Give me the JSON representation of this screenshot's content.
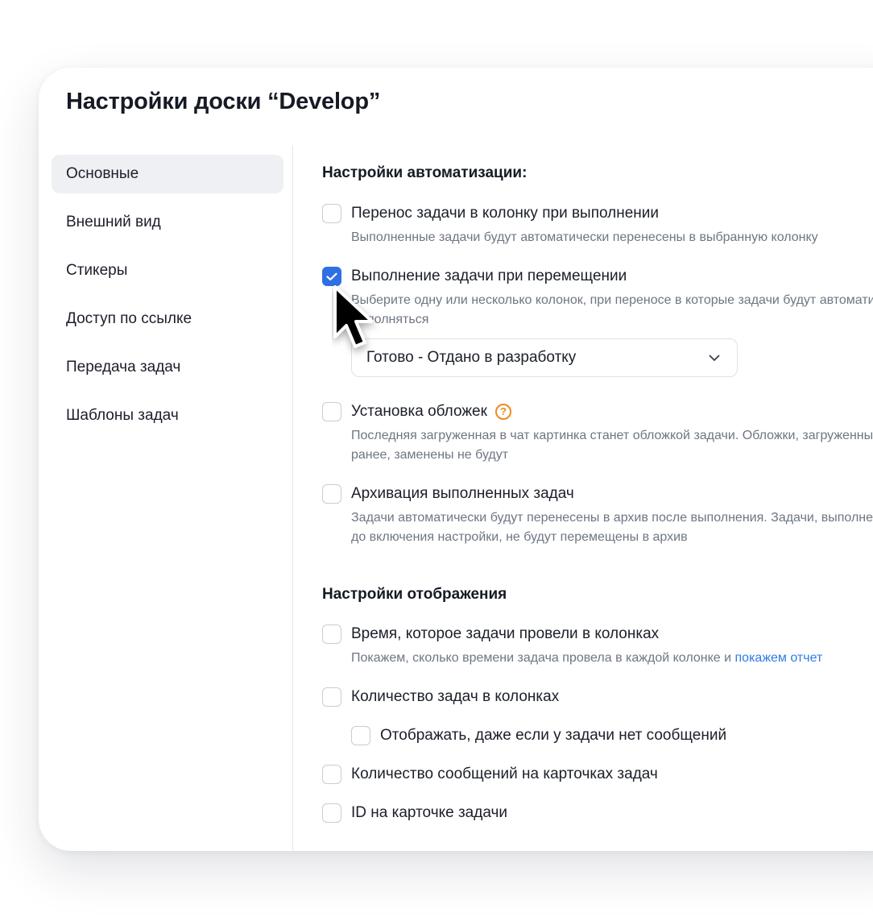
{
  "dialog": {
    "title": "Настройки доски “Develop”"
  },
  "sidebar": {
    "items": [
      {
        "label": "Основные",
        "active": true
      },
      {
        "label": "Внешний вид"
      },
      {
        "label": "Стикеры"
      },
      {
        "label": "Доступ по ссылке"
      },
      {
        "label": "Передача задач"
      },
      {
        "label": "Шаблоны задач"
      }
    ]
  },
  "automation": {
    "title": "Настройки автоматизации:",
    "move_on_done": {
      "label": "Перенос задачи в колонку при выполнении",
      "desc": "Выполненные задачи будут автоматически перенесены в выбранную колонку",
      "checked": false
    },
    "done_on_move": {
      "label": "Выполнение задачи при перемещении",
      "desc": "Выберите одну или несколько колонок, при переносе в которые задачи будут автоматически выполняться",
      "checked": true,
      "select_value": "Готово - Отдано в разработку"
    },
    "covers": {
      "label": "Установка обложек",
      "desc": "Последняя загруженная в чат картинка станет обложкой задачи. Обложки, загруженные ранее, заменены не будут",
      "checked": false,
      "help_glyph": "?"
    },
    "archive": {
      "label": "Архивация выполненных задач",
      "desc": "Задачи автоматически будут перенесены в архив после выполнения. Задачи, выполненные до включения настройки, не будут перемещены в архив",
      "checked": false
    }
  },
  "display": {
    "title": "Настройки отображения",
    "time_in_columns": {
      "label": "Время, которое задачи провели в колонках",
      "desc": "Покажем, сколько времени задача провела в каждой колонке и ",
      "link": "покажем отчет",
      "checked": false
    },
    "task_count": {
      "label": "Количество задач в колонках",
      "checked": false
    },
    "show_without_messages": {
      "label": "Отображать, даже если у задачи нет сообщений",
      "checked": false
    },
    "message_count": {
      "label": "Количество сообщений на карточках задач",
      "checked": false
    },
    "card_id": {
      "label": "ID на карточке задачи",
      "checked": false
    }
  },
  "colors": {
    "accent": "#2f6fe4",
    "link": "#2d7de3",
    "help": "#f08a1c",
    "active_nav": "#eef0f4"
  }
}
